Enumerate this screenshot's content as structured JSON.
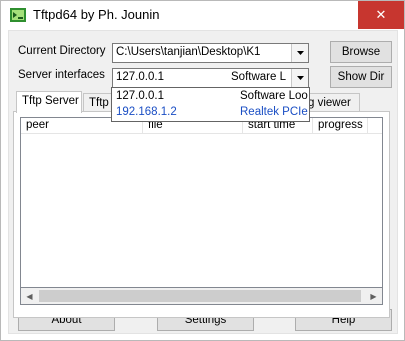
{
  "window": {
    "title": "Tftpd64 by Ph. Jounin",
    "close_glyph": "✕"
  },
  "form": {
    "current_directory_label": "Current Directory",
    "current_directory_value": "C:\\Users\\tanjian\\Desktop\\K1",
    "server_interfaces_label": "Server interfaces",
    "server_interfaces_ip": "127.0.0.1",
    "server_interfaces_desc": "Software L",
    "browse_label": "Browse",
    "show_dir_label": "Show Dir"
  },
  "tabs": [
    {
      "label": "Tftp Server"
    },
    {
      "label": "Tftp C"
    },
    {
      "label": "g viewer"
    }
  ],
  "dropdown": {
    "items": [
      {
        "ip": "127.0.0.1",
        "desc": "Software Loop"
      },
      {
        "ip": "192.168.1.2",
        "desc": "Realtek PCIe G"
      }
    ]
  },
  "table": {
    "columns": [
      "peer",
      "file",
      "start time",
      "progress"
    ]
  },
  "bottom": {
    "about_label": "About",
    "settings_label": "Settings",
    "help_label": "Help"
  },
  "colors": {
    "close_button": "#c7362f",
    "dropdown_highlight_text": "#1a4ec4",
    "client_background": "#f0f0f0"
  }
}
